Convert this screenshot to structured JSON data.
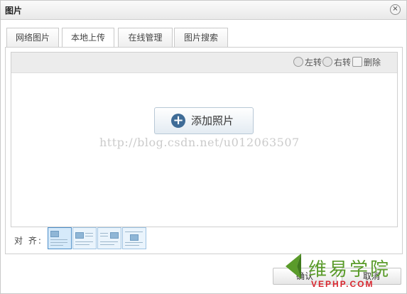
{
  "dialog": {
    "title": "图片",
    "close_icon": "close-icon"
  },
  "tabs": [
    {
      "label": "网络图片",
      "active": false
    },
    {
      "label": "本地上传",
      "active": true
    },
    {
      "label": "在线管理",
      "active": false
    },
    {
      "label": "图片搜索",
      "active": false
    }
  ],
  "toolbar": {
    "rotate_left": "左转",
    "rotate_right": "右转",
    "delete": "删除"
  },
  "upload": {
    "add_button": "添加照片",
    "watermark": "http://blog.csdn.net/u012063507"
  },
  "align": {
    "label": "对 齐:",
    "options": [
      "none",
      "left",
      "right",
      "center"
    ],
    "selected": "none"
  },
  "footer": {
    "confirm": "确认",
    "cancel": "取消"
  },
  "logo": {
    "cn": "维易学院",
    "en": "VEPHP.COM"
  },
  "colors": {
    "accent": "#3f6c97",
    "logo_green": "#5a9b2a",
    "logo_red": "#d9262e"
  }
}
